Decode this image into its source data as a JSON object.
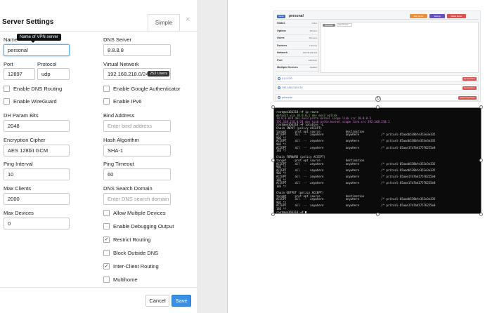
{
  "modal": {
    "title": "Server Settings",
    "simple_tab": "Simple",
    "close": "×",
    "tooltip": "Name of VPN server",
    "fields": {
      "name_label": "Name",
      "name_value": "personal",
      "dns_server_label": "DNS Server",
      "dns_server_value": "8.8.8.8",
      "port_label": "Port",
      "port_value": "12897",
      "protocol_label": "Protocol",
      "protocol_value": "udp",
      "virtual_network_label": "Virtual Network",
      "virtual_network_value": "192.168.218.0/24",
      "virtual_network_badge": "253 Users",
      "dh_param_label": "DH Param Bits",
      "dh_param_value": "2048",
      "bind_address_label": "Bind Address",
      "bind_address_placeholder": "Enter bind address",
      "cipher_label": "Encryption Cipher",
      "cipher_value": "AES 128bit GCM",
      "hash_label": "Hash Algorithm",
      "hash_value": "SHA-1",
      "ping_interval_label": "Ping Interval",
      "ping_interval_value": "10",
      "ping_timeout_label": "Ping Timeout",
      "ping_timeout_value": "60",
      "max_clients_label": "Max Clients",
      "max_clients_value": "2000",
      "dns_search_label": "DNS Search Domain",
      "dns_search_placeholder": "Enter DNS search domain",
      "max_devices_label": "Max Devices",
      "max_devices_value": "0"
    },
    "checkboxes": {
      "dns_routing": {
        "label": "Enable DNS Routing",
        "checked": false
      },
      "google_auth": {
        "label": "Enable Google Authenticator",
        "checked": false
      },
      "wireguard": {
        "label": "Enable WireGuard",
        "checked": false
      },
      "ipv6": {
        "label": "Enable IPv6",
        "checked": false
      },
      "multiple_devices": {
        "label": "Allow Multiple Devices",
        "checked": false
      },
      "debugging": {
        "label": "Enable Debugging Output",
        "checked": false
      },
      "restrict_routing": {
        "label": "Restrict Routing",
        "checked": true
      },
      "block_dns": {
        "label": "Block Outside DNS",
        "checked": false
      },
      "inter_client": {
        "label": "Inter-Client Routing",
        "checked": true
      },
      "multihome": {
        "label": "Multihome",
        "checked": false
      }
    },
    "cancel_label": "Cancel",
    "save_label": "Save",
    "check_glyph": "✓"
  },
  "thumbnail": {
    "tag": "Server",
    "title": "personal",
    "buttons": {
      "start": "Stop Server",
      "settings": "Settings",
      "delete": "Delete Server"
    },
    "stats": [
      {
        "key": "Status",
        "value": "Online"
      },
      {
        "key": "Uptime",
        "value": "38 hours"
      },
      {
        "key": "Users",
        "value": "523 users"
      },
      {
        "key": "Devices",
        "value": "0 devices"
      },
      {
        "key": "Network",
        "value": "192.168.218.0/24"
      },
      {
        "key": "Port",
        "value": "12897/udp"
      },
      {
        "key": "Multiple Devices",
        "value": "Disabled"
      }
    ],
    "graph_button": "Bandwidth",
    "graph_select": "Last 24 hours",
    "routes": [
      {
        "label": "0.0.0.0/0",
        "button": "Remove Route"
      },
      {
        "label": "192.168.218.0/24",
        "button": "Remove Route"
      },
      {
        "label": "personal",
        "button": "Detach Organization"
      }
    ],
    "colors": {
      "blue": "#3b6fc2",
      "orange": "#e8903a",
      "purple": "#6a4fc0",
      "red": "#d9534f"
    }
  },
  "terminal": {
    "lines": [
      {
        "text": "root@vm166318:~# ip route",
        "color": ""
      },
      {
        "text": "default via 10.0.0.1 dev ens3 onlink",
        "color": "g"
      },
      {
        "text": "10.0.0.0/8 dev ens3 proto kernel scope link src 10.0.0.3",
        "color": "p"
      },
      {
        "text": "192.168.218.0/24 dev tun0 proto kernel scope link src 192.168.218.1",
        "color": "p"
      },
      {
        "text": "root@vm166318:~# iptables -L",
        "color": ""
      },
      {
        "text": "Chain INPUT (policy ACCEPT)",
        "color": ""
      },
      {
        "text": "target     prot opt source               destination",
        "color": ""
      },
      {
        "text": "ACCEPT     all  --  anywhere             anywhere             /* pritunl-65aadb538bfe353e3e335",
        "color": ""
      },
      {
        "text": "902 */",
        "color": ""
      },
      {
        "text": "ACCEPT     all  --  anywhere             anywhere             /* pritunl-65aadb538bfe353e3e335",
        "color": ""
      },
      {
        "text": "902 */",
        "color": ""
      },
      {
        "text": "ACCEPT     all  --  anywhere             anywhere             /* pritunl-65aae17d7bd17576225e0",
        "color": ""
      },
      {
        "text": "183 */",
        "color": ""
      },
      {
        "text": "",
        "color": ""
      },
      {
        "text": "Chain FORWARD (policy ACCEPT)",
        "color": ""
      },
      {
        "text": "target     prot opt source               destination",
        "color": ""
      },
      {
        "text": "ACCEPT     all  --  anywhere             anywhere             /* pritunl-65aadb538bfe353e3e335",
        "color": ""
      },
      {
        "text": "902 */",
        "color": ""
      },
      {
        "text": "ACCEPT     all  --  anywhere             anywhere             /* pritunl-65aadb538bfe353e3e335",
        "color": ""
      },
      {
        "text": "902 */",
        "color": ""
      },
      {
        "text": "ACCEPT     all  --  anywhere             anywhere             /* pritunl-65aae17d7bd17576225e0",
        "color": ""
      },
      {
        "text": "183 */",
        "color": ""
      },
      {
        "text": "ACCEPT     all  --  anywhere             anywhere             /* pritunl-65aae17d7bd17576225e0",
        "color": ""
      },
      {
        "text": "183 */",
        "color": ""
      },
      {
        "text": "",
        "color": ""
      },
      {
        "text": "Chain OUTPUT (policy ACCEPT)",
        "color": ""
      },
      {
        "text": "target     prot opt source               destination",
        "color": ""
      },
      {
        "text": "ACCEPT     all  --  anywhere             anywhere             /* pritunl-65aadb538bfe353e3e335",
        "color": ""
      },
      {
        "text": "902 */",
        "color": ""
      },
      {
        "text": "ACCEPT     all  --  anywhere             anywhere             /* pritunl-65aae17d7bd17576225e0",
        "color": ""
      },
      {
        "text": "183 */",
        "color": ""
      },
      {
        "text": "root@vm166318:~# ",
        "color": "",
        "cursor": true
      }
    ]
  }
}
